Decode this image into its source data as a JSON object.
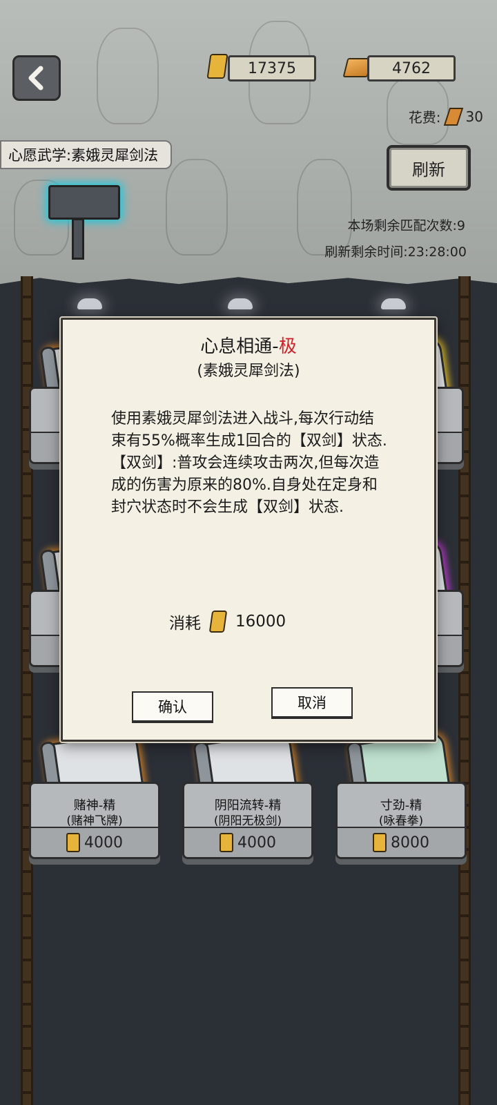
{
  "header": {
    "scroll_currency": "17375",
    "gold_currency": "4762",
    "refresh_cost_label": "花费:",
    "refresh_cost_value": "30",
    "wish_martial": "心愿武学:素娥灵犀剑法",
    "refresh_button": "刷新",
    "match_remaining": "本场剩余匹配次数:9",
    "refresh_time": "刷新剩余时间:23:28:00"
  },
  "dialog": {
    "title_main": "心息相通-",
    "title_grade": "极",
    "subtitle": "(素娥灵犀剑法)",
    "description": "使用素娥灵犀剑法进入战斗,每次行动结束有55%概率生成1回合的【双剑】状态.【双剑】:普攻会连续攻击两次,但每次造成的伤害为原来的80%.自身处在定身和封穴状态时不会生成【双剑】状态.",
    "cost_label": "消耗",
    "cost_value": "16000",
    "confirm_label": "确认",
    "cancel_label": "取消"
  },
  "shelf_items": [
    {
      "name": "赌神-精",
      "school": "(赌神飞牌)",
      "price": "4000",
      "color": "gray"
    },
    {
      "name": "阴阳流转-精",
      "school": "(阴阳无极剑)",
      "price": "4000",
      "color": "gray"
    },
    {
      "name": "寸劲-精",
      "school": "(咏春拳)",
      "price": "8000",
      "color": "green"
    }
  ],
  "colors": {
    "grade_red": "#d2202a",
    "glow_orange": "#e68c28",
    "sign_glow": "#28c6d8"
  }
}
